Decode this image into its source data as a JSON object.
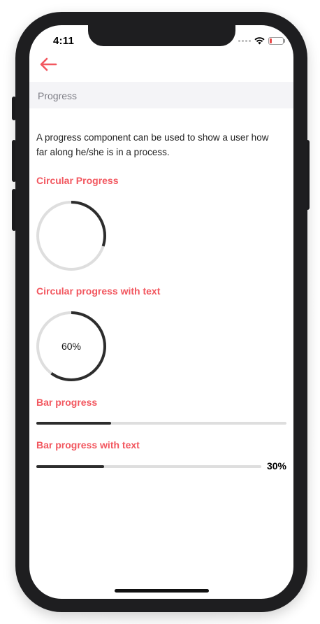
{
  "status_bar": {
    "time": "4:11",
    "battery_level": 0.15
  },
  "header": {
    "back_icon": "arrow-left-icon",
    "accent_color": "#f2575f"
  },
  "section": {
    "title": "Progress"
  },
  "description": "A progress component can be used to show a user how far along he/she is in a process.",
  "circular_progress": {
    "label": "Circular Progress",
    "value": 0.3
  },
  "circular_progress_text": {
    "label": "Circular progress with text",
    "value": 0.6,
    "text": "60%"
  },
  "bar_progress": {
    "label": "Bar progress",
    "value": 0.3
  },
  "bar_progress_text": {
    "label": "Bar progress with text",
    "value": 0.3,
    "text": "30%"
  },
  "colors": {
    "accent": "#f2575f",
    "progress": "#2d2d2d",
    "track": "#dedede"
  }
}
